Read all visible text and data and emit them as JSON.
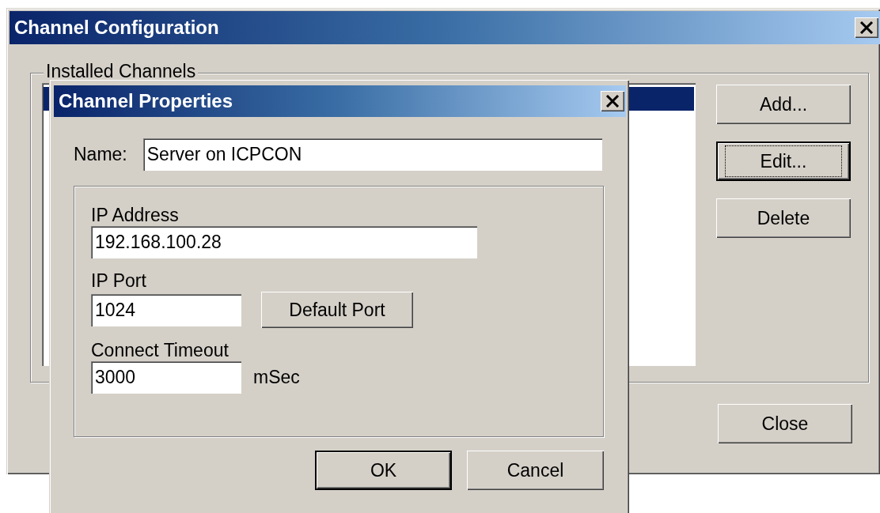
{
  "window": {
    "title": "Channel Configuration"
  },
  "installed_channels": {
    "label": "Installed Channels"
  },
  "buttons": [
    {
      "label": "Add...",
      "default": false,
      "focused": false
    },
    {
      "label": "Edit...",
      "default": true,
      "focused": true
    },
    {
      "label": "Delete",
      "default": false,
      "focused": false
    }
  ],
  "close_button": {
    "label": "Close"
  },
  "dialog": {
    "title": "Channel Properties",
    "name_label": "Name:",
    "name_value": "Server on ICPCON",
    "fields": [
      {
        "kind": "wide",
        "label": "IP Address",
        "value": "192.168.100.28"
      },
      {
        "kind": "with_button",
        "label": "IP Port",
        "value": "1024",
        "button": "Default Port"
      },
      {
        "kind": "with_unit",
        "label": "Connect Timeout",
        "value": "3000",
        "unit": "mSec"
      }
    ],
    "buttons": [
      {
        "label": "OK",
        "default": true
      },
      {
        "label": "Cancel",
        "default": false
      }
    ]
  }
}
